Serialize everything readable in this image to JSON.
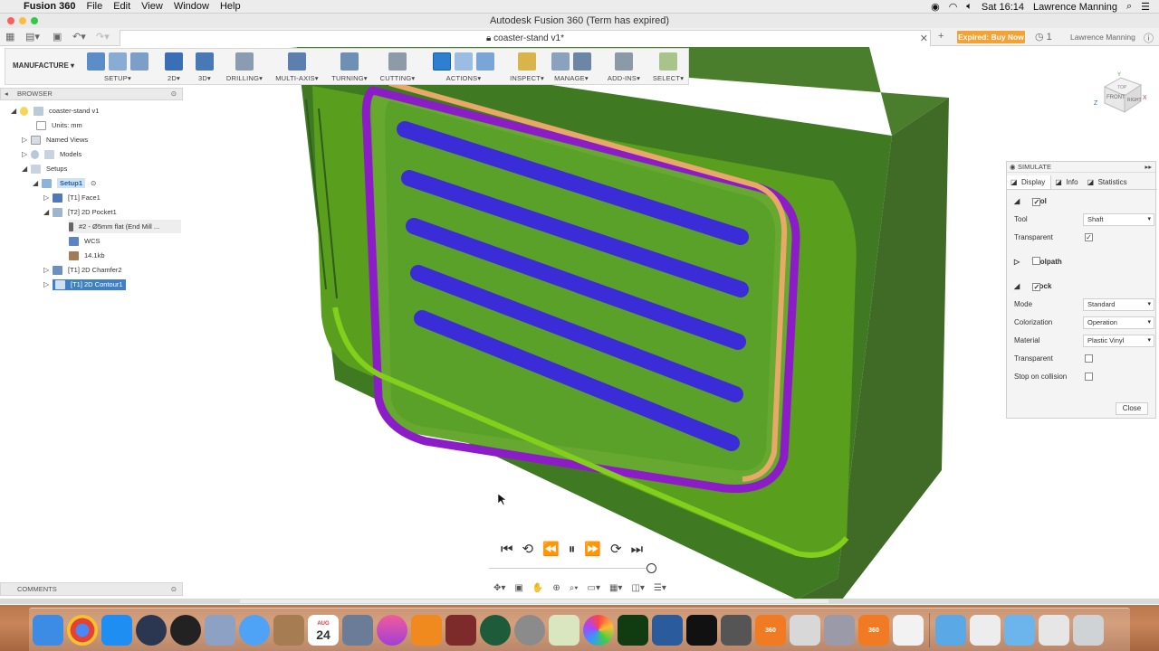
{
  "menubar": {
    "app_name": "Fusion 360",
    "menus": [
      "File",
      "Edit",
      "View",
      "Window",
      "Help"
    ],
    "clock": "Sat 16:14",
    "user": "Lawrence Manning"
  },
  "window": {
    "title": "Autodesk Fusion 360 (Term has expired)"
  },
  "tabbar": {
    "doc_tab": "coaster-stand v1*",
    "buy_label": "Expired: Buy Now",
    "notif_count": "1",
    "user": "Lawrence Manning"
  },
  "toolbar": {
    "workspace": "MANUFACTURE",
    "groups": [
      "SETUP",
      "2D",
      "3D",
      "DRILLING",
      "MULTI-AXIS",
      "TURNING",
      "CUTTING",
      "ACTIONS",
      "INSPECT",
      "MANAGE",
      "ADD-INS",
      "SELECT"
    ]
  },
  "browser": {
    "title": "BROWSER",
    "items": {
      "root": "coaster-stand v1",
      "units": "Units: mm",
      "named_views": "Named Views",
      "models": "Models",
      "setups": "Setups",
      "setup1": "Setup1",
      "face1": "[T1] Face1",
      "pocket": "[T2] 2D Pocket1",
      "tool": "#2 - Ø5mm flat (End Mill ...",
      "wcs": "WCS",
      "size": "14.1kb",
      "chamfer": "[T1] 2D Chamfer2",
      "contour": "[T1] 2D Contour1"
    }
  },
  "comments": {
    "title": "COMMENTS"
  },
  "simulate": {
    "title": "SIMULATE",
    "tabs": [
      "Display",
      "Info",
      "Statistics"
    ],
    "tool_section": "Tool",
    "tool_label": "Tool",
    "tool_value": "Shaft",
    "transparent_label": "Transparent",
    "toolpath_section": "Toolpath",
    "stock_section": "Stock",
    "mode_label": "Mode",
    "mode_value": "Standard",
    "colorization_label": "Colorization",
    "colorization_value": "Operation",
    "material_label": "Material",
    "material_value": "Plastic Vinyl",
    "stock_transparent_label": "Transparent",
    "stop_label": "Stop on collision",
    "close_label": "Close"
  },
  "viewcube": {
    "front": "FRONT",
    "right": "RIGHT",
    "top": "TOP"
  },
  "dock": {
    "calendar_month": "AUG",
    "calendar_day": "24",
    "fusion_label": "360"
  }
}
